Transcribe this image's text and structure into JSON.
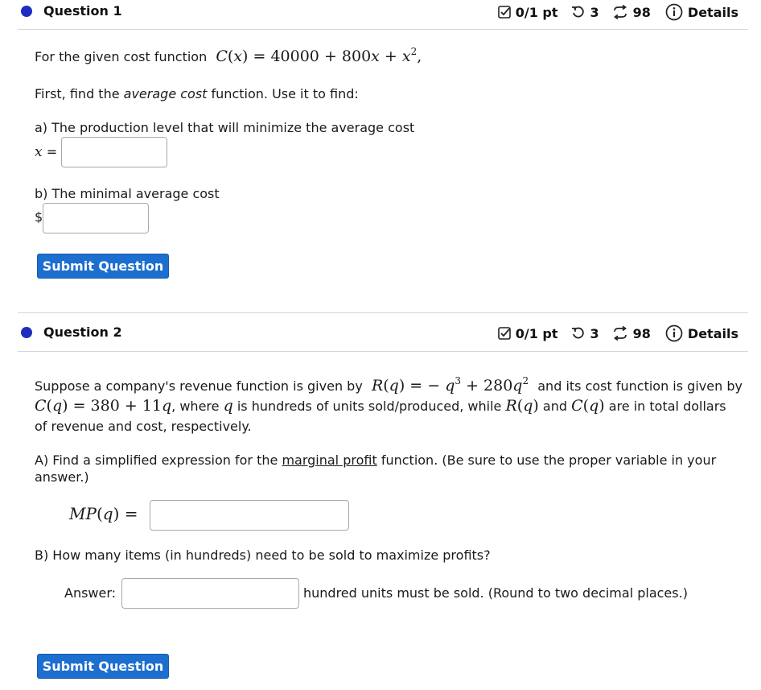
{
  "q1": {
    "title": "Question 1",
    "score": "0/1 pt",
    "retries": "3",
    "attempts": "98",
    "details": "Details",
    "intro_text": "For the given cost function",
    "first_pre": "First, find the",
    "first_em": "average cost",
    "first_post": "function. Use it to find:",
    "part_a": "a) The production level that will minimize the average cost",
    "x_label": "=",
    "part_b": "b) The minimal average cost",
    "dollar": "$",
    "submit": "Submit Question"
  },
  "q2": {
    "title": "Question 2",
    "score": "0/1 pt",
    "retries": "3",
    "attempts": "98",
    "details": "Details",
    "p1a": "Suppose a company's revenue function is given by",
    "p1b": "and its cost function is given by",
    "p2a": ", where",
    "p2b": "is hundreds of units sold/produced, while",
    "p2c": "and",
    "p2d": "are in total dollars",
    "p3": "of revenue and cost, respectively.",
    "partA_pre": "A) Find a simplified expression for the",
    "partA_link": "marginal profit",
    "partA_post": "function. (Be sure to use the proper variable in your",
    "partA_line2": "answer.)",
    "partB": "B) How many items (in hundreds) need to be sold to maximize profits?",
    "answer_label": "Answer:",
    "answer_suffix": "hundred units must be sold. (Round to two decimal places.)",
    "submit": "Submit Question"
  },
  "colors": {
    "accent": "#1d6fcf",
    "dot": "#1f2dbf",
    "rule": "#d6d6d6"
  }
}
